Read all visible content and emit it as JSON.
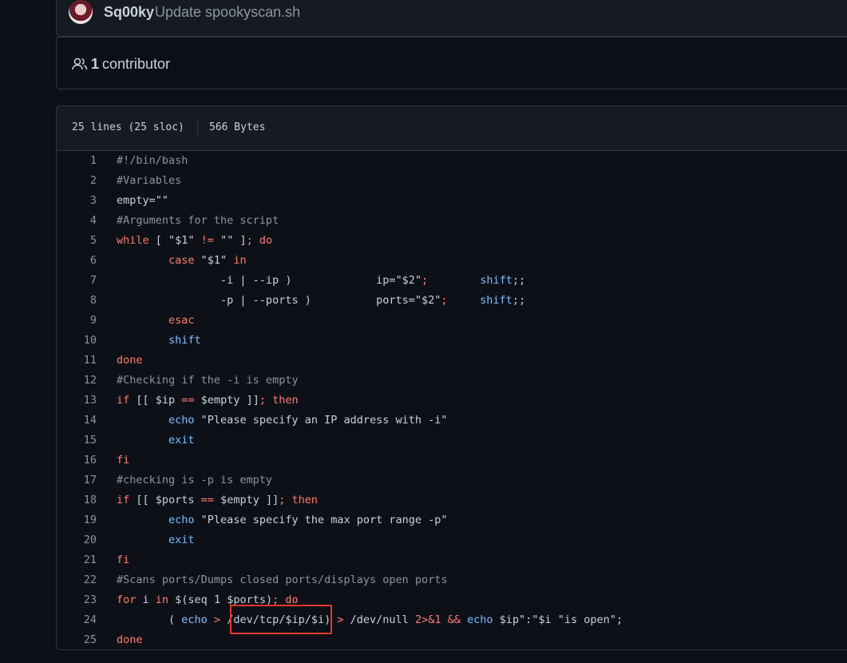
{
  "commit": {
    "author": "Sq00ky",
    "message": "Update spookyscan.sh"
  },
  "contributors": {
    "count": "1",
    "label": "contributor"
  },
  "file": {
    "lines_info": "25 lines (25 sloc)",
    "size": "566 Bytes"
  },
  "code_lines": [
    [
      {
        "c": "cm",
        "t": "#!/bin/bash"
      }
    ],
    [
      {
        "c": "cm",
        "t": "#Variables"
      }
    ],
    [
      {
        "c": "",
        "t": "empty=\"\""
      }
    ],
    [
      {
        "c": "cm",
        "t": "#Arguments for the script"
      }
    ],
    [
      {
        "c": "kw",
        "t": "while"
      },
      {
        "c": "",
        "t": " [ \"$1\" "
      },
      {
        "c": "kw",
        "t": "!="
      },
      {
        "c": "",
        "t": " \"\" ]"
      },
      {
        "c": "kw",
        "t": "; do"
      }
    ],
    [
      {
        "c": "",
        "t": "        "
      },
      {
        "c": "kw",
        "t": "case"
      },
      {
        "c": "",
        "t": " \"$1\" "
      },
      {
        "c": "kw",
        "t": "in"
      }
    ],
    [
      {
        "c": "",
        "t": "                -i | --ip )             ip="
      },
      {
        "c": "",
        "t": "\"$2\""
      },
      {
        "c": "kw",
        "t": ";"
      },
      {
        "c": "",
        "t": "        "
      },
      {
        "c": "bi",
        "t": "shift"
      },
      {
        "c": "",
        "t": ";;"
      }
    ],
    [
      {
        "c": "",
        "t": "                -p | --ports )          ports="
      },
      {
        "c": "",
        "t": "\"$2\""
      },
      {
        "c": "kw",
        "t": ";"
      },
      {
        "c": "",
        "t": "     "
      },
      {
        "c": "bi",
        "t": "shift"
      },
      {
        "c": "",
        "t": ";;"
      }
    ],
    [
      {
        "c": "",
        "t": "        "
      },
      {
        "c": "kw",
        "t": "esac"
      }
    ],
    [
      {
        "c": "",
        "t": "        "
      },
      {
        "c": "bi",
        "t": "shift"
      }
    ],
    [
      {
        "c": "kw",
        "t": "done"
      }
    ],
    [
      {
        "c": "cm",
        "t": "#Checking if the -i is empty"
      }
    ],
    [
      {
        "c": "kw",
        "t": "if"
      },
      {
        "c": "",
        "t": " [[ $ip "
      },
      {
        "c": "kw",
        "t": "=="
      },
      {
        "c": "",
        "t": " $empty ]]"
      },
      {
        "c": "kw",
        "t": "; then"
      }
    ],
    [
      {
        "c": "",
        "t": "        "
      },
      {
        "c": "bi",
        "t": "echo"
      },
      {
        "c": "",
        "t": " \"Please specify an IP address with -i\""
      }
    ],
    [
      {
        "c": "",
        "t": "        "
      },
      {
        "c": "bi",
        "t": "exit"
      }
    ],
    [
      {
        "c": "kw",
        "t": "fi"
      }
    ],
    [
      {
        "c": "cm",
        "t": "#checking is -p is empty"
      }
    ],
    [
      {
        "c": "kw",
        "t": "if"
      },
      {
        "c": "",
        "t": " [[ $ports "
      },
      {
        "c": "kw",
        "t": "=="
      },
      {
        "c": "",
        "t": " $empty ]]"
      },
      {
        "c": "kw",
        "t": "; then"
      }
    ],
    [
      {
        "c": "",
        "t": "        "
      },
      {
        "c": "bi",
        "t": "echo"
      },
      {
        "c": "",
        "t": " \"Please specify the max port range -p\""
      }
    ],
    [
      {
        "c": "",
        "t": "        "
      },
      {
        "c": "bi",
        "t": "exit"
      }
    ],
    [
      {
        "c": "kw",
        "t": "fi"
      }
    ],
    [
      {
        "c": "cm",
        "t": "#Scans ports/Dumps closed ports/displays open ports"
      }
    ],
    [
      {
        "c": "kw",
        "t": "for"
      },
      {
        "c": "",
        "t": " i "
      },
      {
        "c": "kw",
        "t": "in"
      },
      {
        "c": "",
        "t": " $(seq 1 $ports)"
      },
      {
        "c": "kw",
        "t": "; do"
      }
    ],
    [
      {
        "c": "",
        "t": "        ( "
      },
      {
        "c": "bi",
        "t": "echo"
      },
      {
        "c": "",
        "t": " "
      },
      {
        "c": "kw",
        "t": ">"
      },
      {
        "c": "",
        "t": " /dev/tcp/$ip/$i) "
      },
      {
        "c": "kw",
        "t": ">"
      },
      {
        "c": "",
        "t": " /dev/null "
      },
      {
        "c": "kw",
        "t": "2>&1 &&"
      },
      {
        "c": "",
        "t": " "
      },
      {
        "c": "bi",
        "t": "echo"
      },
      {
        "c": "",
        "t": " $ip\":\"$i \"is open\";"
      }
    ],
    [
      {
        "c": "kw",
        "t": "done"
      }
    ]
  ]
}
